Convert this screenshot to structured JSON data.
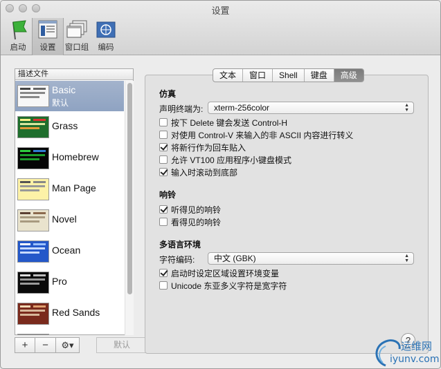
{
  "window": {
    "title": "设置"
  },
  "toolbar": {
    "items": [
      {
        "label": "启动",
        "icon": "startup-flag-icon"
      },
      {
        "label": "设置",
        "icon": "settings-window-icon"
      },
      {
        "label": "窗口组",
        "icon": "window-group-icon"
      },
      {
        "label": "编码",
        "icon": "encoding-globe-icon"
      }
    ],
    "selected": "设置"
  },
  "profiles": {
    "header": "描述文件",
    "items": [
      {
        "name": "Basic",
        "subtitle": "默认",
        "selected": true
      },
      {
        "name": "Grass"
      },
      {
        "name": "Homebrew"
      },
      {
        "name": "Man Page"
      },
      {
        "name": "Novel"
      },
      {
        "name": "Ocean"
      },
      {
        "name": "Pro"
      },
      {
        "name": "Red Sands"
      }
    ],
    "add_label": "+",
    "remove_label": "−",
    "gear_label": "⚙▾",
    "default_label": "默认"
  },
  "tabs": [
    {
      "label": "文本"
    },
    {
      "label": "窗口"
    },
    {
      "label": "Shell"
    },
    {
      "label": "键盘"
    },
    {
      "label": "高级",
      "active": true
    }
  ],
  "emulation": {
    "heading": "仿真",
    "terminal_label": "声明终端为:",
    "terminal_value": "xterm-256color",
    "options": [
      {
        "label": "按下 Delete 键会发送 Control-H",
        "checked": false
      },
      {
        "label": "对使用 Control-V 来输入的非 ASCII 内容进行转义",
        "checked": false
      },
      {
        "label": "将新行作为回车贴入",
        "checked": true
      },
      {
        "label": "允许 VT100 应用程序小键盘模式",
        "checked": false
      },
      {
        "label": "输入时滚动到底部",
        "checked": true
      }
    ]
  },
  "bell": {
    "heading": "响铃",
    "options": [
      {
        "label": "听得见的响铃",
        "checked": true
      },
      {
        "label": "看得见的响铃",
        "checked": false
      }
    ]
  },
  "international": {
    "heading": "多语言环境",
    "encoding_label": "字符编码:",
    "encoding_value": "中文 (GBK)",
    "options": [
      {
        "label": "启动时设定区域设置环境变量",
        "checked": true
      },
      {
        "label": "Unicode 东亚多义字符是宽字符",
        "checked": false
      }
    ]
  },
  "help_label": "?",
  "watermark": {
    "cn": "运维网",
    "en": "iyunv.com"
  }
}
